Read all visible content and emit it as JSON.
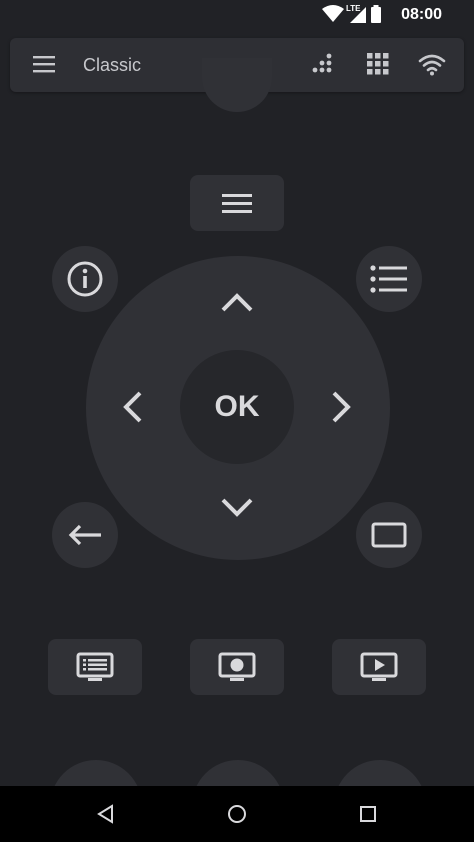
{
  "status": {
    "time": "08:00",
    "network": "LTE"
  },
  "toolbar": {
    "title": "Classic"
  },
  "remote": {
    "ok_label": "OK"
  },
  "icons": {
    "menu": "hamburger-menu-icon",
    "dots": "dotpad-icon",
    "grid": "grid-icon",
    "wifi": "wifi-icon",
    "info": "info-icon",
    "list": "list-icon",
    "back": "back-arrow-icon",
    "tv": "tv-screen-icon",
    "guide": "guide-icon",
    "record": "record-icon",
    "play": "play-icon"
  },
  "colors": {
    "background": "#212226",
    "button": "#303136",
    "ok_center": "#26272b",
    "icon": "#d9d9dc"
  }
}
